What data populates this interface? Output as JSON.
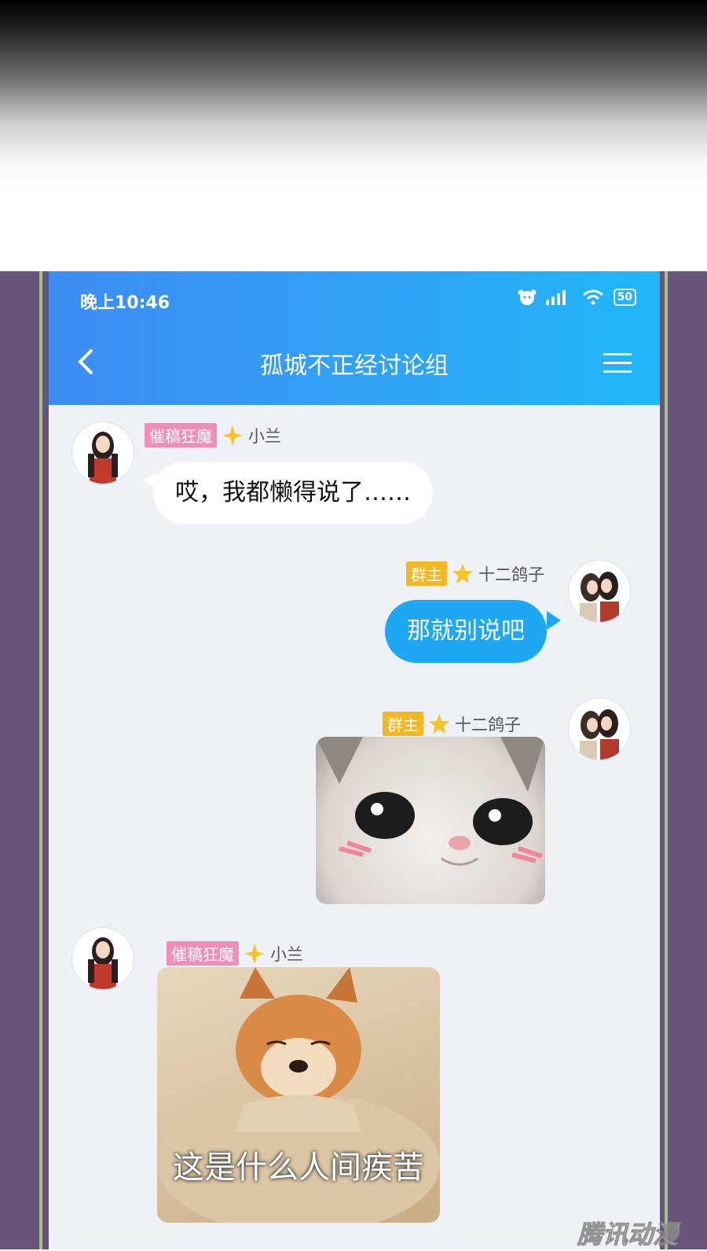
{
  "status_bar": {
    "time": "晚上10:46",
    "battery": "50"
  },
  "header": {
    "title": "孤城不正经讨论组"
  },
  "messages": [
    {
      "badge": "催稿狂魔",
      "name": "小兰",
      "text": "哎，我都懒得说了……"
    },
    {
      "badge": "群主",
      "name": "十二鸽子",
      "text": "那就别说吧"
    },
    {
      "badge": "群主",
      "name": "十二鸽子"
    },
    {
      "badge": "催稿狂魔",
      "name": "小兰",
      "image_caption": "这是什么人间疾苦"
    }
  ],
  "watermark": "腾讯动漫",
  "colors": {
    "header_start": "#3d8cf2",
    "header_end": "#20b7f8",
    "bubble_blue": "#1ea7f2",
    "badge_pink": "#ef8fb9",
    "badge_gold": "#f2b824"
  }
}
